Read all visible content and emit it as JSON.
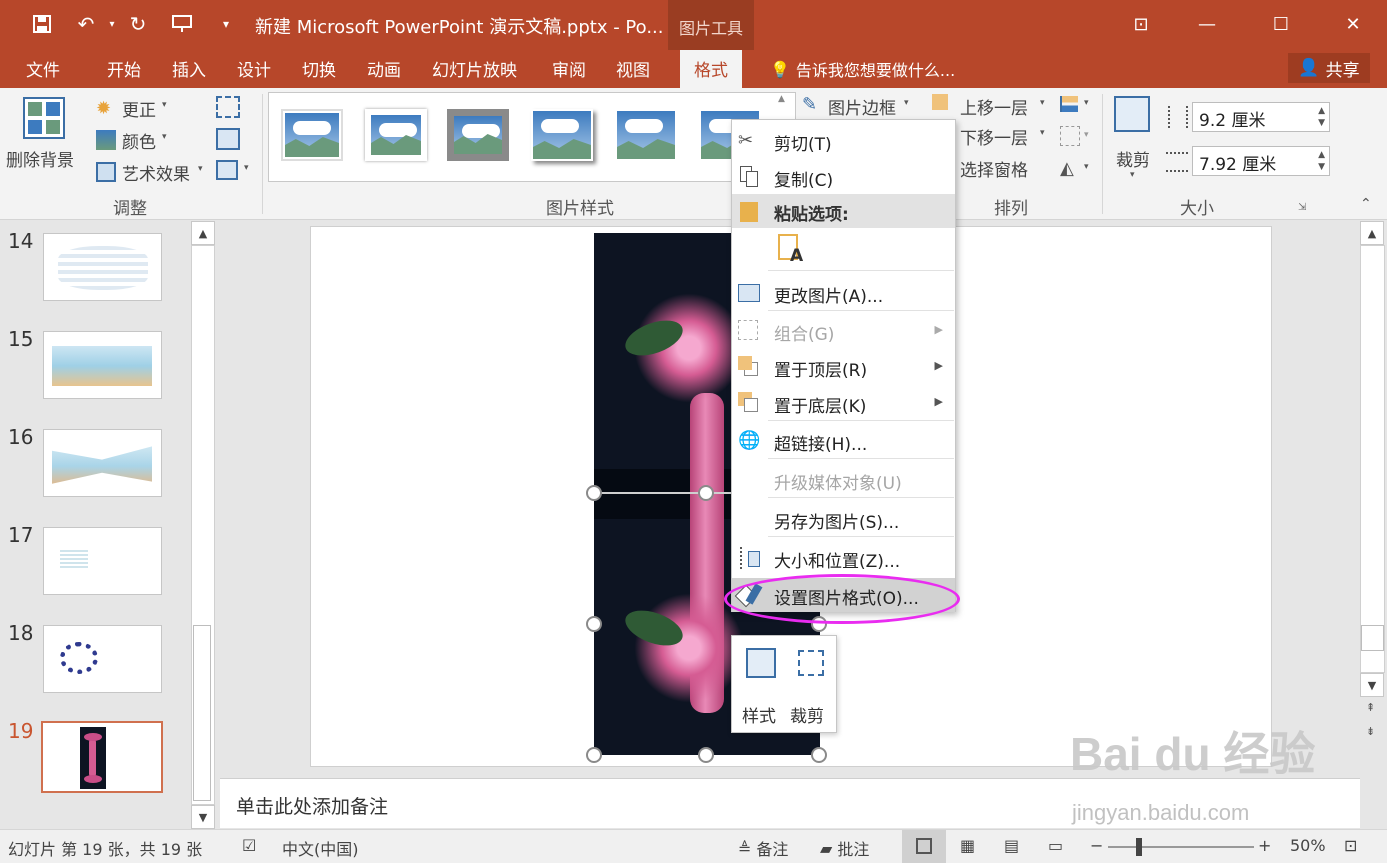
{
  "window": {
    "title": "新建 Microsoft PowerPoint 演示文稿.pptx - Po...",
    "context_tab_group": "图片工具",
    "controls": {
      "minimize": "—",
      "restore": "☐",
      "close": "✕",
      "ribbon_display": "⊡"
    }
  },
  "tabs": [
    {
      "label": "文件"
    },
    {
      "label": "开始"
    },
    {
      "label": "插入"
    },
    {
      "label": "设计"
    },
    {
      "label": "切换"
    },
    {
      "label": "动画"
    },
    {
      "label": "幻灯片放映"
    },
    {
      "label": "审阅"
    },
    {
      "label": "视图"
    },
    {
      "label": "格式"
    }
  ],
  "tell_me": "告诉我您想要做什么...",
  "share": "共享",
  "ribbon": {
    "remove_bg": "删除背景",
    "corrections": "更正",
    "color": "颜色",
    "artistic": "艺术效果",
    "adjust_group": "调整",
    "styles_group": "图片样式",
    "picture_border": "图片边框",
    "bring_forward": "上移一层",
    "send_backward": "下移一层",
    "selection_pane": "选择窗格",
    "arrange_group": "排列",
    "crop": "裁剪",
    "height": "9.2 厘米",
    "width": "7.92 厘米",
    "size_group": "大小"
  },
  "slides": [
    {
      "num": "14"
    },
    {
      "num": "15"
    },
    {
      "num": "16"
    },
    {
      "num": "17"
    },
    {
      "num": "18"
    },
    {
      "num": "19"
    }
  ],
  "notes_placeholder": "单击此处添加备注",
  "context_menu": {
    "cut": "剪切(T)",
    "copy": "复制(C)",
    "paste_options": "粘贴选项:",
    "change_picture": "更改图片(A)...",
    "group": "组合(G)",
    "bring_to_front": "置于顶层(R)",
    "send_to_back": "置于底层(K)",
    "hyperlink": "超链接(H)...",
    "upgrade_media": "升级媒体对象(U)",
    "save_as_picture": "另存为图片(S)...",
    "size_position": "大小和位置(Z)...",
    "format_picture": "设置图片格式(O)..."
  },
  "mini_toolbar": {
    "style": "样式",
    "crop": "裁剪"
  },
  "status": {
    "slide_info": "幻灯片 第 19 张，共 19 张",
    "language": "中文(中国)",
    "notes": "备注",
    "comments": "批注",
    "zoom": "50%"
  },
  "watermark": {
    "brand": "Bai du 经验",
    "url": "jingyan.baidu.com"
  },
  "colors": {
    "accent": "#b7472a",
    "highlight_oval": "#e92cf0",
    "active_slide": "#c9552f"
  }
}
